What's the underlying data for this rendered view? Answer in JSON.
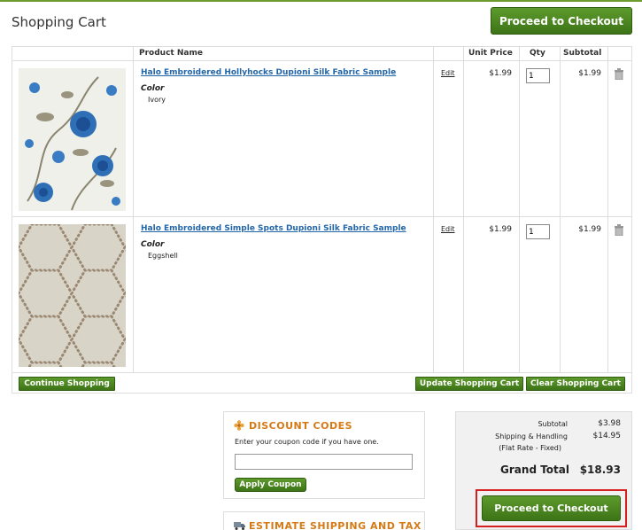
{
  "page": {
    "title": "Shopping Cart",
    "checkout_label": "Proceed to Checkout"
  },
  "table": {
    "headers": {
      "product_name": "Product Name",
      "unit_price": "Unit Price",
      "qty": "Qty",
      "subtotal": "Subtotal"
    },
    "items": [
      {
        "name": "Halo Embroidered Hollyhocks Dupioni Silk Fabric Sample",
        "option_label": "Color",
        "option_value": "Ivory",
        "edit_label": "Edit",
        "unit_price": "$1.99",
        "qty": "1",
        "subtotal": "$1.99",
        "image_icon": "floral-fabric-swatch"
      },
      {
        "name": "Halo Embroidered Simple Spots Dupioni Silk Fabric Sample",
        "option_label": "Color",
        "option_value": "Eggshell",
        "edit_label": "Edit",
        "unit_price": "$1.99",
        "qty": "1",
        "subtotal": "$1.99",
        "image_icon": "dotted-hexagon-fabric-swatch"
      }
    ],
    "actions": {
      "continue": "Continue Shopping",
      "update": "Update Shopping Cart",
      "clear": "Clear Shopping Cart"
    }
  },
  "discount": {
    "title": "DISCOUNT CODES",
    "note": "Enter your coupon code if you have one.",
    "coupon_value": "",
    "apply": "Apply Coupon",
    "icon": "flower-icon"
  },
  "estimate": {
    "title": "ESTIMATE SHIPPING AND TAX",
    "icon": "truck-icon"
  },
  "totals": {
    "subtotal_label": "Subtotal",
    "subtotal": "$3.98",
    "shipping_label": "Shipping & Handling",
    "shipping_note": "(Flat Rate - Fixed)",
    "shipping": "$14.95",
    "grand_label": "Grand Total",
    "grand": "$18.93"
  },
  "colors": {
    "accent_green": "#4a8a20",
    "accent_orange": "#d67a16",
    "link_blue": "#2266a8",
    "highlight_red": "#d61f1f"
  }
}
